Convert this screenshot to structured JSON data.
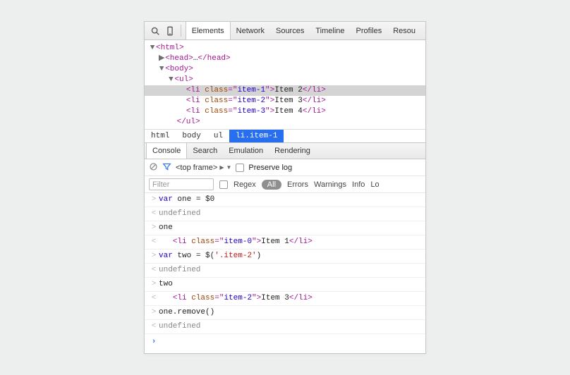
{
  "toolbar": {
    "tabs": [
      "Elements",
      "Network",
      "Sources",
      "Timeline",
      "Profiles",
      "Resou"
    ],
    "active": 0
  },
  "elements": {
    "l0": {
      "open": "<html>"
    },
    "l1": {
      "open": "<head>",
      "ellipsis": "…",
      "close": "</head>"
    },
    "l2": {
      "open": "<body>"
    },
    "l3": {
      "open": "<ul>"
    },
    "li": [
      {
        "tag_open": "<li ",
        "attr": "class",
        "eq": "=\"",
        "val": "item-1",
        "q": "\">",
        "text": "Item 2",
        "close": "</li>"
      },
      {
        "tag_open": "<li ",
        "attr": "class",
        "eq": "=\"",
        "val": "item-2",
        "q": "\">",
        "text": "Item 3",
        "close": "</li>"
      },
      {
        "tag_open": "<li ",
        "attr": "class",
        "eq": "=\"",
        "val": "item-3",
        "q": "\">",
        "text": "Item 4",
        "close": "</li>"
      }
    ],
    "ul_close": "</ul>"
  },
  "breadcrumb": [
    "html",
    "body",
    "ul",
    "li.item-1"
  ],
  "drawer": {
    "tabs": [
      "Console",
      "Search",
      "Emulation",
      "Rendering"
    ],
    "active": 0
  },
  "console": {
    "frame": "<top frame>",
    "preserve_label": "Preserve log",
    "filter_placeholder": "Filter",
    "regex_label": "Regex",
    "levels": [
      "All",
      "Errors",
      "Warnings",
      "Info",
      "Lo"
    ],
    "rows": [
      {
        "g": ">",
        "plain": "var one = $0"
      },
      {
        "g": "<",
        "muted": "undefined"
      },
      {
        "g": ">",
        "plain": "one"
      },
      {
        "g": "<",
        "el": {
          "indent": "   ",
          "tag_open": "<li ",
          "attr": "class",
          "eq": "=\"",
          "val": "item-0",
          "q": "\">",
          "text": "Item 1",
          "close": "</li>"
        }
      },
      {
        "g": ">",
        "code": {
          "pre": "var two = ",
          "fn": "$",
          "paren_open": "(",
          "str": "'.item-2'",
          "paren_close": ")"
        }
      },
      {
        "g": "<",
        "muted": "undefined"
      },
      {
        "g": ">",
        "plain": "two"
      },
      {
        "g": "<",
        "el": {
          "indent": "   ",
          "tag_open": "<li ",
          "attr": "class",
          "eq": "=\"",
          "val": "item-2",
          "q": "\">",
          "text": "Item 3",
          "close": "</li>"
        }
      },
      {
        "g": ">",
        "plain": "one.remove()"
      },
      {
        "g": "<",
        "muted": "undefined"
      }
    ]
  }
}
